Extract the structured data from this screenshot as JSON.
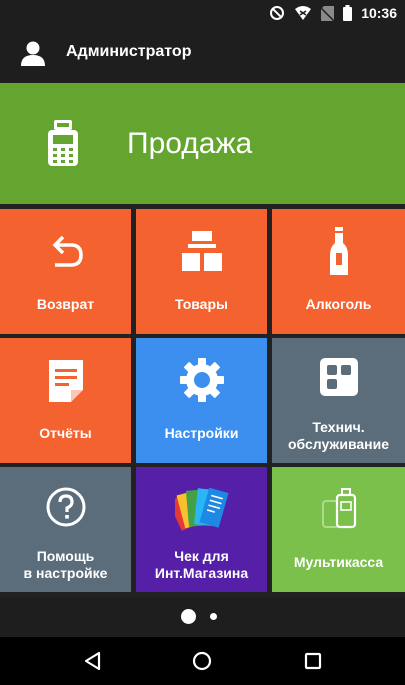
{
  "status_bar": {
    "time": "10:36",
    "icons": [
      "do-not-disturb-icon",
      "wifi-icon",
      "no-sim-icon",
      "battery-icon"
    ]
  },
  "user": {
    "name": "Администратор",
    "icon": "person-icon"
  },
  "sale": {
    "label": "Продажа",
    "icon": "payment-terminal-icon",
    "color": "#63a52e"
  },
  "tiles": [
    {
      "id": "return",
      "label": "Возврат",
      "icon": "undo-arrow-icon",
      "color": "#f4622f"
    },
    {
      "id": "goods",
      "label": "Товары",
      "icon": "boxes-icon",
      "color": "#f4622f"
    },
    {
      "id": "alcohol",
      "label": "Алкоголь",
      "icon": "bottle-icon",
      "color": "#f4622f"
    },
    {
      "id": "reports",
      "label": "Отчёты",
      "icon": "document-icon",
      "color": "#f4622f"
    },
    {
      "id": "settings",
      "label": "Настройки",
      "icon": "gear-icon",
      "color": "#3d8fef"
    },
    {
      "id": "maintenance",
      "label_line1": "Технич.",
      "label_line2": "обслуживание",
      "icon": "grid-squares-icon",
      "color": "#5b6d7a"
    },
    {
      "id": "help",
      "label_line1": "Помощь",
      "label_line2": "в настройке",
      "icon": "question-circle-icon",
      "color": "#5b6d7a"
    },
    {
      "id": "online-receipt",
      "label_line1": "Чек для",
      "label_line2": "Инт.Магазина",
      "icon": "receipt-fan-icon",
      "color": "#551fa8"
    },
    {
      "id": "multikassa",
      "label": "Мультикасса",
      "icon": "devices-icon",
      "color": "#7cc04c"
    }
  ],
  "pager": {
    "pages": 2,
    "current": 1
  },
  "nav": [
    "back-icon",
    "home-icon",
    "recents-icon"
  ]
}
